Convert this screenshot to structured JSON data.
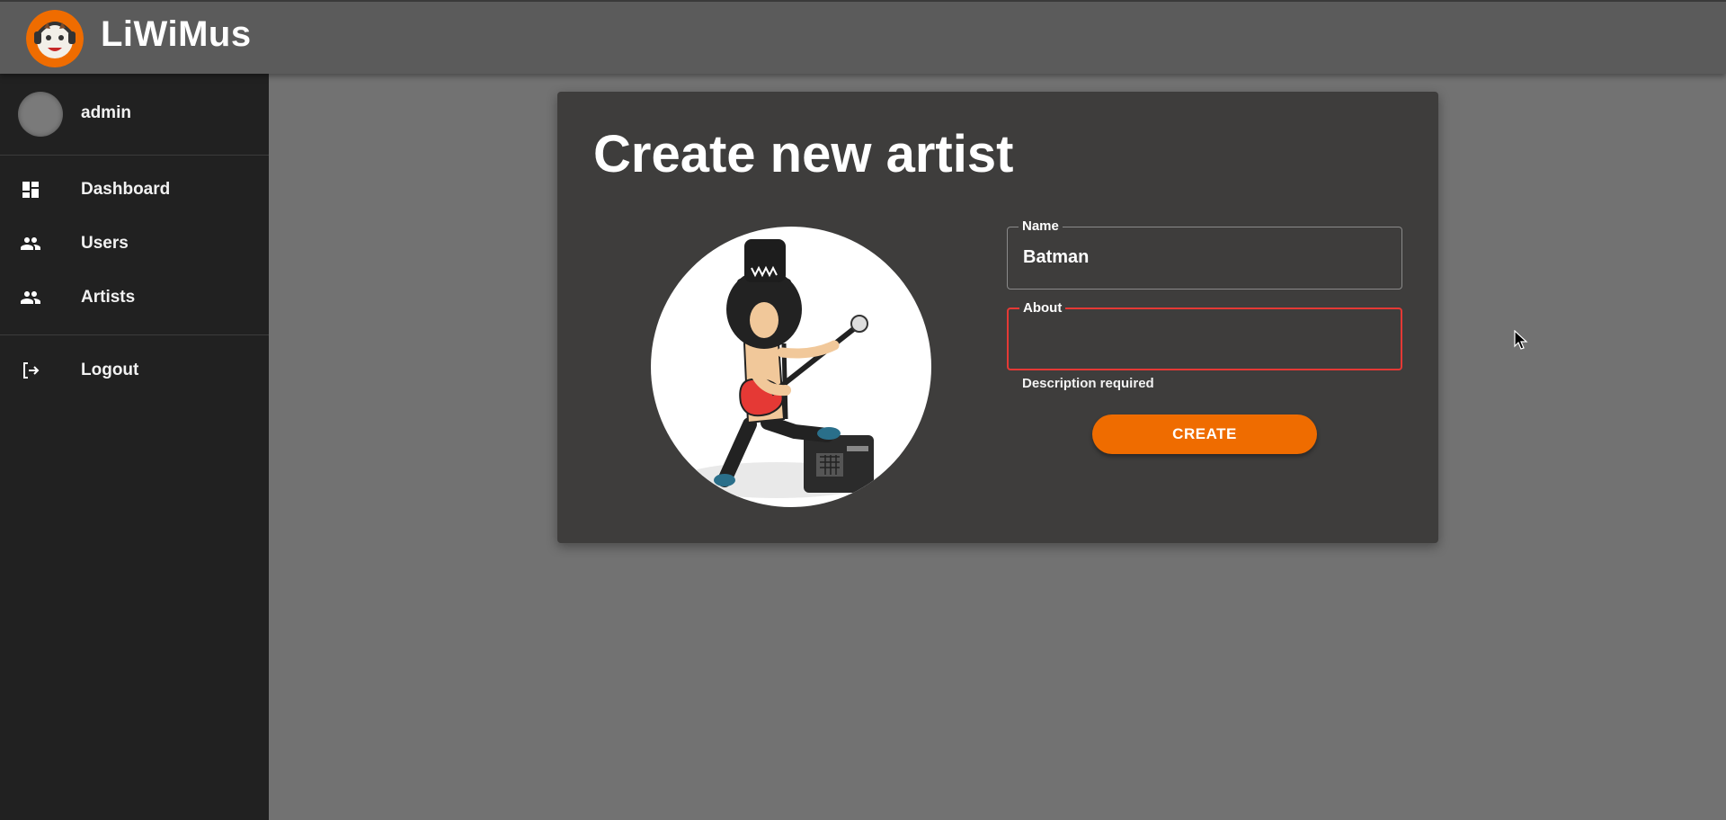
{
  "app": {
    "title": "LiWiMus"
  },
  "sidebar": {
    "user": {
      "name": "admin"
    },
    "items": [
      {
        "label": "Dashboard",
        "icon": "dashboard-icon"
      },
      {
        "label": "Users",
        "icon": "people-icon"
      },
      {
        "label": "Artists",
        "icon": "people-icon"
      },
      {
        "label": "Logout",
        "icon": "logout-icon"
      }
    ]
  },
  "form": {
    "title": "Create new artist",
    "name": {
      "label": "Name",
      "value": "Batman"
    },
    "about": {
      "label": "About",
      "value": "",
      "error": "Description required"
    },
    "submit_label": "CREATE"
  },
  "colors": {
    "accent": "#ef6c00",
    "error": "#e53935",
    "sidebar": "#212121",
    "topbar": "#5b5b5b",
    "card": "#3e3d3c",
    "background": "#727272"
  }
}
